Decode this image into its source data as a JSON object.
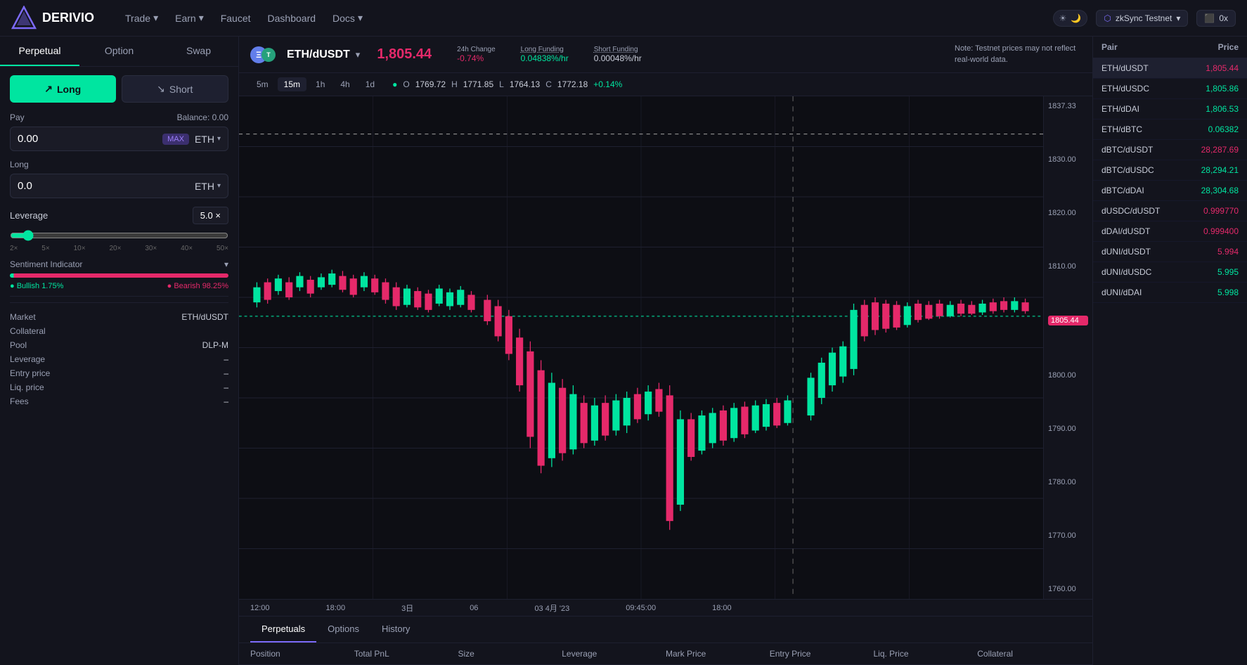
{
  "app": {
    "logo": "DERIVIO",
    "logo_icon": "▲"
  },
  "nav": {
    "trade_label": "Trade",
    "earn_label": "Earn",
    "faucet_label": "Faucet",
    "dashboard_label": "Dashboard",
    "docs_label": "Docs",
    "network_label": "zkSync Testnet",
    "wallet_label": "0x",
    "theme_icon": "🌙"
  },
  "left_panel": {
    "tabs": [
      "Perpetual",
      "Option",
      "Swap"
    ],
    "active_tab": 0,
    "long_label": "Long",
    "short_label": "Short",
    "pay_label": "Pay",
    "balance_label": "Balance: 0.00",
    "pay_value": "0.00",
    "pay_token": "ETH",
    "max_label": "MAX",
    "long_section_label": "Long",
    "long_value": "0.0",
    "long_token": "ETH",
    "leverage_label": "Leverage",
    "leverage_value": "5.0",
    "leverage_unit": "×",
    "leverage_marks": [
      "2×",
      "5×",
      "10×",
      "20×",
      "30×",
      "40×",
      "50×"
    ],
    "sentiment_label": "Sentiment Indicator",
    "bullish_label": "Bullish",
    "bullish_pct": "1.75%",
    "bearish_label": "Bearish",
    "bearish_pct": "98.25%",
    "info_rows": [
      {
        "key": "Market",
        "val": "ETH/dUSDT"
      },
      {
        "key": "Collateral",
        "val": ""
      },
      {
        "key": "Pool",
        "val": "DLP-M"
      },
      {
        "key": "Leverage",
        "val": "–"
      },
      {
        "key": "Entry price",
        "val": "–"
      },
      {
        "key": "Liq. price",
        "val": "–"
      },
      {
        "key": "Fees",
        "val": "–"
      }
    ]
  },
  "chart_header": {
    "pair": "ETH/dUSDT",
    "price": "1,805.44",
    "change_label": "24h Change",
    "change_val": "-0.74%",
    "long_funding_label": "Long Funding",
    "long_funding_val": "0.04838%/hr",
    "short_funding_label": "Short Funding",
    "short_funding_val": "0.00048%/hr",
    "note": "Note: Testnet prices may not reflect real-world data."
  },
  "timeframes": [
    "5m",
    "15m",
    "1h",
    "4h",
    "1d"
  ],
  "active_tf": "15m",
  "ohlc": {
    "o_label": "O",
    "o_val": "1769.72",
    "h_label": "H",
    "h_val": "1771.85",
    "l_label": "L",
    "l_val": "1764.13",
    "c_label": "C",
    "c_val": "1772.18",
    "chg": "+0.14%"
  },
  "price_axis": [
    "1837.33",
    "1830.00",
    "1820.00",
    "1810.00",
    "1800.00",
    "1790.00",
    "1780.00",
    "1770.00",
    "1760.00"
  ],
  "current_price_label": "1805.44",
  "time_axis": [
    "12:00",
    "18:00",
    "3日",
    "06",
    "03 4月 '23",
    "09:45:00",
    "18:00"
  ],
  "bottom_tabs": [
    "Perpetuals",
    "Options",
    "History"
  ],
  "active_bottom_tab": 0,
  "table_headers": [
    "Position",
    "Total PnL",
    "Size",
    "Leverage",
    "Mark Price",
    "Entry Price",
    "Liq. Price",
    "Collateral"
  ],
  "right_panel": {
    "header_pair": "Pair",
    "header_price": "Price",
    "rows": [
      {
        "pair": "ETH/dUSDT",
        "price": "1,805.44",
        "color": "red",
        "active": true
      },
      {
        "pair": "ETH/dUSDC",
        "price": "1,805.86",
        "color": "green"
      },
      {
        "pair": "ETH/dDAI",
        "price": "1,806.53",
        "color": "green"
      },
      {
        "pair": "ETH/dBTC",
        "price": "0.06382",
        "color": "green"
      },
      {
        "pair": "dBTC/dUSDT",
        "price": "28,287.69",
        "color": "red"
      },
      {
        "pair": "dBTC/dUSDC",
        "price": "28,294.21",
        "color": "green"
      },
      {
        "pair": "dBTC/dDAI",
        "price": "28,304.68",
        "color": "green"
      },
      {
        "pair": "dUSDC/dUSDT",
        "price": "0.999770",
        "color": "red"
      },
      {
        "pair": "dDAI/dUSDT",
        "price": "0.999400",
        "color": "red"
      },
      {
        "pair": "dUNI/dUSDT",
        "price": "5.994",
        "color": "red"
      },
      {
        "pair": "dUNI/dUSDC",
        "price": "5.995",
        "color": "green"
      },
      {
        "pair": "dUNI/dDAI",
        "price": "5.998",
        "color": "green"
      }
    ]
  }
}
